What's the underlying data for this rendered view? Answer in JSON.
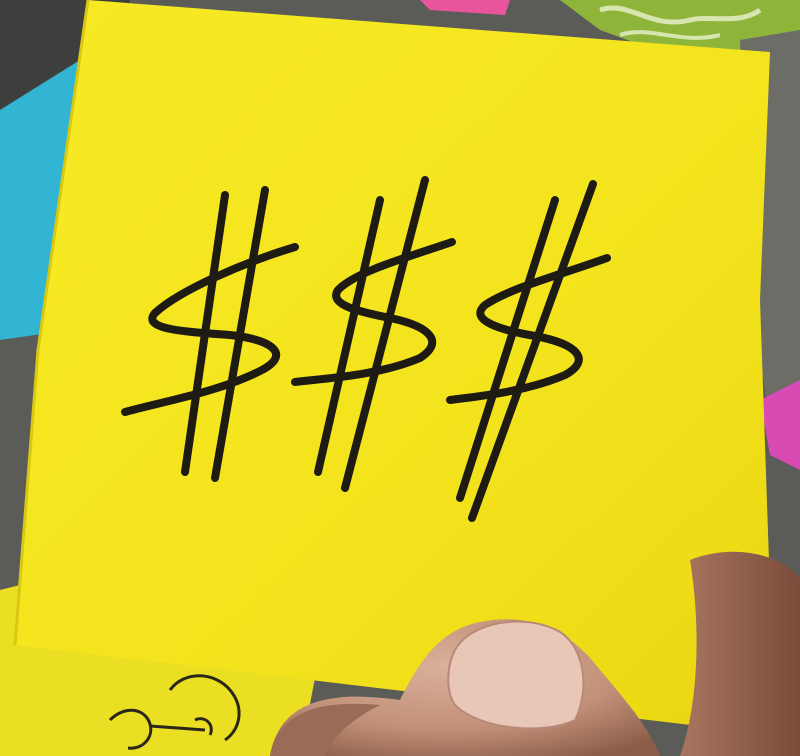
{
  "scene": {
    "subject": "",
    "colors": {
      "note": "#f4e61e",
      "note_shadow": "#d9c80f",
      "ink": "#1c1a12",
      "cyan_note": "#33b8d4",
      "pink_note": "#e24ca8",
      "green_note": "#8fb635",
      "skin": "#c99a80",
      "background": "#5a5b55"
    }
  },
  "sticky_note": {
    "handwriting": "$$$"
  }
}
